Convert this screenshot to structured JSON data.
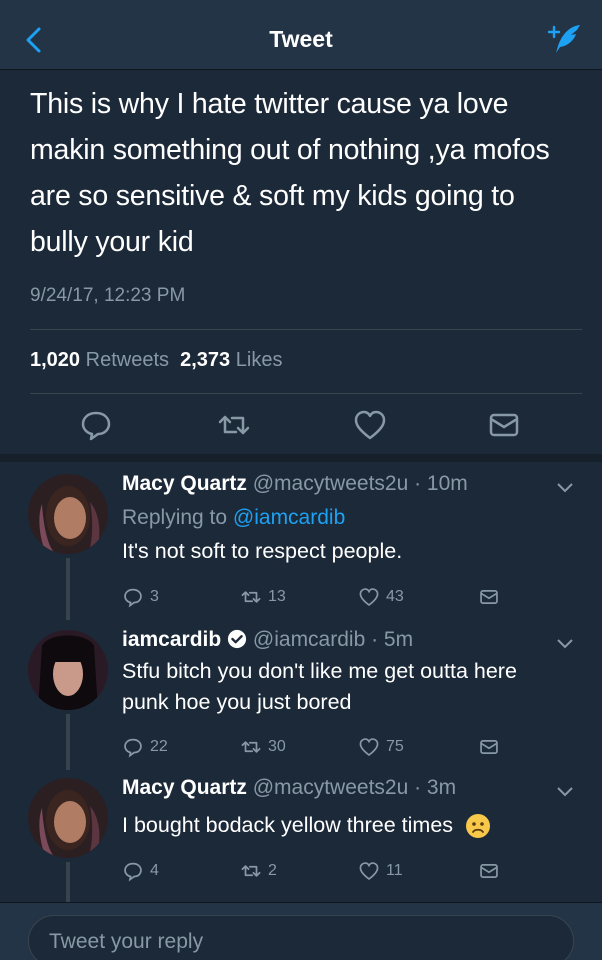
{
  "nav": {
    "title": "Tweet"
  },
  "main_tweet": {
    "text": "This is why I hate twitter cause ya love makin something out of nothing ,ya mofos are so sensitive & soft my kids going to bully your kid",
    "timestamp": "9/24/17, 12:23 PM",
    "retweets_count": "1,020",
    "retweets_label": "Retweets",
    "likes_count": "2,373",
    "likes_label": "Likes"
  },
  "replies": [
    {
      "name": "Macy Quartz",
      "handle": "@macytweets2u",
      "time": "· 10m",
      "replying_prefix": "Replying to",
      "replying_to": "@iamcardib",
      "text": "It's not soft to respect people.",
      "reply_count": "3",
      "retweet_count": "13",
      "like_count": "43"
    },
    {
      "name": "iamcardib",
      "handle": "@iamcardib",
      "time": "· 5m",
      "verified": true,
      "text": "Stfu bitch you don't like me get outta here punk hoe you just bored",
      "reply_count": "22",
      "retweet_count": "30",
      "like_count": "75"
    },
    {
      "name": "Macy Quartz",
      "handle": "@macytweets2u",
      "time": "· 3m",
      "text": "I bought bodack yellow three times",
      "emoji": "slightly-frowning-face-emoji",
      "reply_count": "4",
      "retweet_count": "2",
      "like_count": "11"
    }
  ],
  "compose": {
    "placeholder": "Tweet your reply"
  },
  "icons": [
    "back-chevron-icon",
    "compose-tweet-icon",
    "reply-icon",
    "retweet-icon",
    "like-heart-icon",
    "direct-message-icon",
    "chevron-down-icon",
    "verified-badge-icon"
  ],
  "colors": {
    "background": "#1c2938",
    "bar": "#243447",
    "accent": "#1da1f2",
    "muted": "#8899a6",
    "divider": "#38444d"
  }
}
